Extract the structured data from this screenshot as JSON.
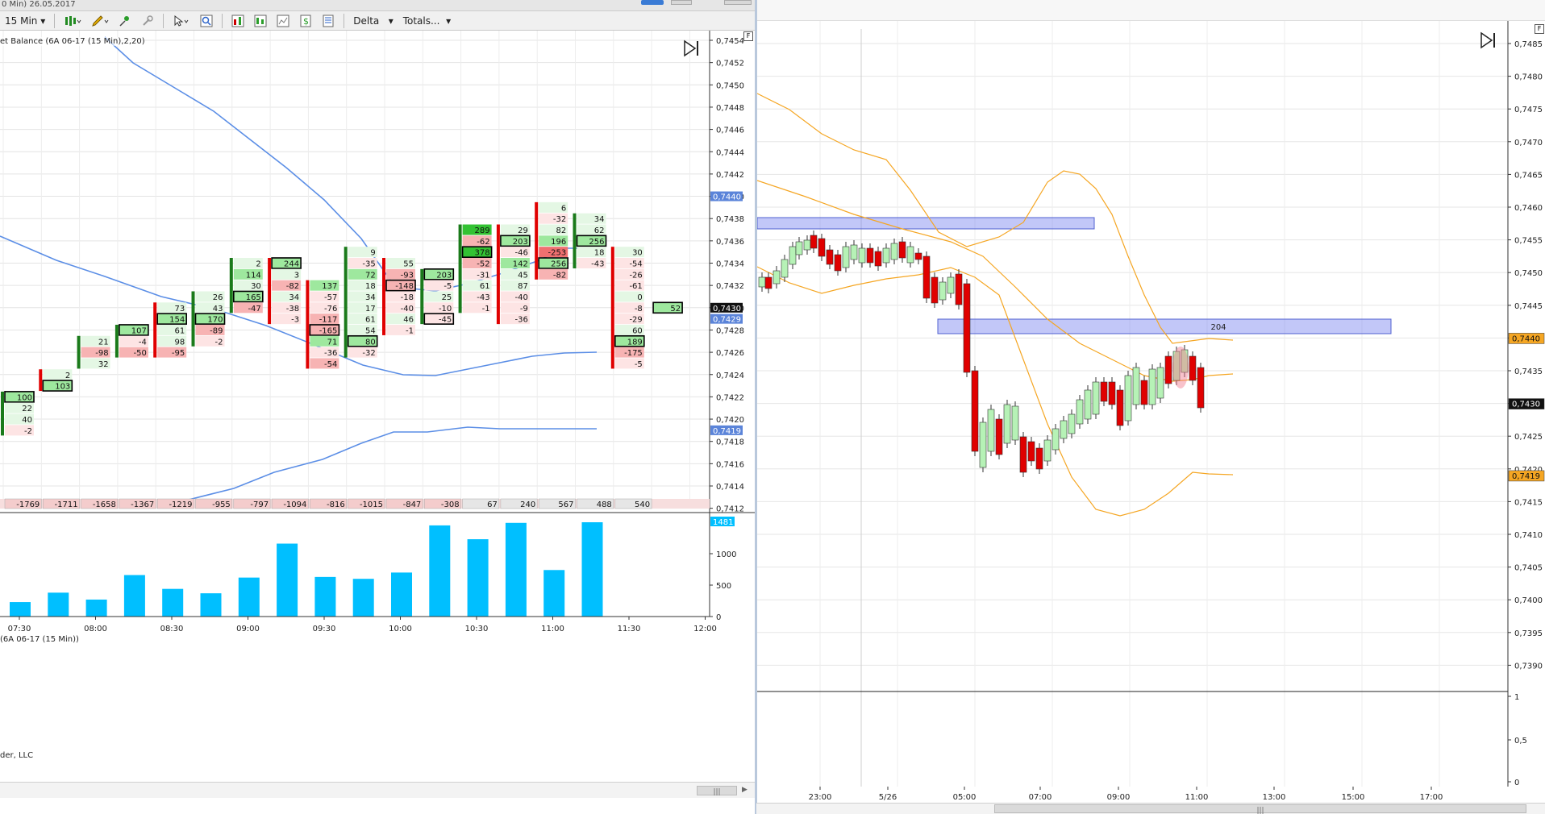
{
  "left_window": {
    "title_fragment": "0 Min)  26.05.2017",
    "toolbar": {
      "interval_label": "15 Min",
      "delta_label": "Delta",
      "totals_label": "Totals..."
    },
    "indicator_label": "et Balance  (6A 06-17 (15 Min),2,20)",
    "volume_label": "(6A 06-17 (15 Min))",
    "copyright": "der, LLC",
    "price_axis": [
      "0,7454",
      "0,7452",
      "0,7450",
      "0,7448",
      "0,7446",
      "0,7444",
      "0,7442",
      "0,7440",
      "0,7438",
      "0,7436",
      "0,7434",
      "0,7432",
      "0,7430",
      "0,7428",
      "0,7426",
      "0,7424",
      "0,7422",
      "0,7420",
      "0,7418",
      "0,7416",
      "0,7414",
      "0,7412"
    ],
    "price_markers": {
      "upper": "0,7440",
      "current": "0,7430",
      "current_sub": "0,7429",
      "lower": "0,7419"
    },
    "volume_axis": [
      "1000",
      "500",
      "0"
    ],
    "volume_marker": "1481",
    "time_axis": [
      "07:30",
      "08:00",
      "08:30",
      "09:00",
      "09:30",
      "10:00",
      "10:30",
      "11:00",
      "11:30",
      "12:00"
    ],
    "totals_row": [
      "-1769",
      "-1711",
      "-1658",
      "-1367",
      "-1219",
      "-955",
      "-797",
      "-1094",
      "-816",
      "-1015",
      "-847",
      "-308",
      "67",
      "240",
      "567",
      "488",
      "540"
    ]
  },
  "right_window": {
    "price_axis": [
      "0,7485",
      "0,7480",
      "0,7475",
      "0,7470",
      "0,7465",
      "0,7460",
      "0,7455",
      "0,7450",
      "0,7445",
      "0,7440",
      "0,7435",
      "0,7430",
      "0,7425",
      "0,7420",
      "0,7415",
      "0,7410",
      "0,7405",
      "0,7400",
      "0,7395",
      "0,7390"
    ],
    "price_markers": {
      "upper": "0,7440",
      "current": "0,7430",
      "lower": "0,7419"
    },
    "indicator_axis": [
      "1",
      "0,5",
      "0"
    ],
    "time_axis": [
      "23:00",
      "5/26",
      "05:00",
      "07:00",
      "09:00",
      "11:00",
      "13:00",
      "15:00",
      "17:00"
    ],
    "zone_label": "204"
  },
  "chart_data": [
    {
      "type": "bar",
      "title": "",
      "series": [
        {
          "name": "",
          "values": [
            230,
            380,
            270,
            660,
            440,
            370,
            620,
            1160,
            630,
            600,
            700,
            1450,
            1230,
            1490,
            740,
            1500
          ]
        }
      ],
      "categories": [
        "07:30",
        "07:45",
        "08:00",
        "08:15",
        "08:30",
        "08:45",
        "09:00",
        "09:15",
        "09:30",
        "09:45",
        "10:00",
        "10:15",
        "10:30",
        "10:45",
        "11:00",
        "11:15"
      ],
      "ylim": [
        0,
        1500
      ],
      "bar_color": "#00bfff"
    }
  ],
  "footprint": [
    {
      "cells": [
        [
          "0,7422",
          "100",
          "box-g"
        ],
        [
          "0,7421",
          "22",
          ""
        ],
        [
          "0,7420",
          "40",
          ""
        ],
        [
          "0,7419",
          "-2",
          ""
        ]
      ]
    },
    {
      "cells": [
        [
          "0,7424",
          "2",
          ""
        ],
        [
          "0,7423",
          "103",
          "box-g"
        ]
      ]
    },
    {
      "cells": [
        [
          "0,7427",
          "21",
          ""
        ],
        [
          "0,7426",
          "-98",
          "r"
        ],
        [
          "0,7425",
          "32",
          ""
        ]
      ]
    },
    {
      "cells": [
        [
          "0,7428",
          "107",
          "box-g"
        ],
        [
          "0,7427",
          "-4",
          ""
        ],
        [
          "0,7426",
          "-50",
          "r"
        ]
      ]
    },
    {
      "cells": [
        [
          "0,7430",
          "73",
          ""
        ],
        [
          "0,7429",
          "154",
          "box-g"
        ],
        [
          "0,7428",
          "61",
          ""
        ],
        [
          "0,7427",
          "98",
          ""
        ],
        [
          "0,7426",
          "-95",
          "r"
        ]
      ]
    },
    {
      "cells": [
        [
          "0,7431",
          "26",
          ""
        ],
        [
          "0,7430",
          "43",
          ""
        ],
        [
          "0,7429",
          "170",
          "box-g"
        ],
        [
          "0,7428",
          "-89",
          "r"
        ],
        [
          "0,7427",
          "-2",
          ""
        ]
      ]
    },
    {
      "cells": [
        [
          "0,7434",
          "2",
          ""
        ],
        [
          "0,7433",
          "114",
          "g"
        ],
        [
          "0,7432",
          "30",
          ""
        ],
        [
          "0,7431",
          "165",
          "box-g"
        ],
        [
          "0,7430",
          "-47",
          "r"
        ]
      ]
    },
    {
      "cells": [
        [
          "0,7434",
          "244",
          "box-g"
        ],
        [
          "0,7433",
          "3",
          ""
        ],
        [
          "0,7432",
          "-82",
          "r"
        ],
        [
          "0,7431",
          "34",
          ""
        ],
        [
          "0,7430",
          "-38",
          ""
        ],
        [
          "0,7429",
          "-3",
          ""
        ]
      ]
    },
    {
      "cells": [
        [
          "0,7432",
          "137",
          "g"
        ],
        [
          "0,7431",
          "-57",
          ""
        ],
        [
          "0,7430",
          "-76",
          ""
        ],
        [
          "0,7429",
          "-117",
          "r"
        ],
        [
          "0,7428",
          "-165",
          "box-r"
        ],
        [
          "0,7427",
          "71",
          "g"
        ],
        [
          "0,7426",
          "-36",
          ""
        ],
        [
          "0,7425",
          "-54",
          "r"
        ]
      ]
    },
    {
      "cells": [
        [
          "0,7435",
          "9",
          ""
        ],
        [
          "0,7434",
          "-35",
          ""
        ],
        [
          "0,7433",
          "72",
          "g"
        ],
        [
          "0,7432",
          "18",
          ""
        ],
        [
          "0,7431",
          "34",
          ""
        ],
        [
          "0,7430",
          "17",
          ""
        ],
        [
          "0,7429",
          "61",
          ""
        ],
        [
          "0,7428",
          "54",
          ""
        ],
        [
          "0,7427",
          "80",
          "box-g"
        ],
        [
          "0,7426",
          "-32",
          ""
        ]
      ]
    },
    {
      "cells": [
        [
          "0,7434",
          "55",
          ""
        ],
        [
          "0,7433",
          "-93",
          "r"
        ],
        [
          "0,7432",
          "-148",
          "box-r"
        ],
        [
          "0,7431",
          "-18",
          ""
        ],
        [
          "0,7430",
          "-40",
          ""
        ],
        [
          "0,7429",
          "46",
          ""
        ],
        [
          "0,7428",
          "-1",
          ""
        ]
      ]
    },
    {
      "cells": [
        [
          "0,7433",
          "203",
          "box-g"
        ],
        [
          "0,7432",
          "-5",
          ""
        ],
        [
          "0,7431",
          "25",
          ""
        ],
        [
          "0,7430",
          "-10",
          ""
        ],
        [
          "0,7429",
          "-45",
          "box"
        ]
      ]
    },
    {
      "cells": [
        [
          "0,7437",
          "289",
          "gg"
        ],
        [
          "0,7436",
          "-62",
          "r"
        ],
        [
          "0,7435",
          "378",
          "box-gg"
        ],
        [
          "0,7434",
          "-52",
          "r"
        ],
        [
          "0,7433",
          "-31",
          ""
        ],
        [
          "0,7432",
          "61",
          ""
        ],
        [
          "0,7431",
          "-43",
          ""
        ],
        [
          "0,7430",
          "-1",
          ""
        ]
      ]
    },
    {
      "cells": [
        [
          "0,7437",
          "29",
          ""
        ],
        [
          "0,7436",
          "203",
          "box-g"
        ],
        [
          "0,7435",
          "-46",
          ""
        ],
        [
          "0,7434",
          "142",
          "g"
        ],
        [
          "0,7433",
          "45",
          ""
        ],
        [
          "0,7432",
          "87",
          ""
        ],
        [
          "0,7431",
          "-40",
          ""
        ],
        [
          "0,7430",
          "-9",
          ""
        ],
        [
          "0,7429",
          "-36",
          ""
        ]
      ]
    },
    {
      "cells": [
        [
          "0,7439",
          "6",
          ""
        ],
        [
          "0,7438",
          "-32",
          ""
        ],
        [
          "0,7437",
          "82",
          ""
        ],
        [
          "0,7436",
          "196",
          "g"
        ],
        [
          "0,7435",
          "-253",
          "rr"
        ],
        [
          "0,7434",
          "256",
          "box-g"
        ],
        [
          "0,7433",
          "-82",
          "r"
        ]
      ]
    },
    {
      "cells": [
        [
          "0,7438",
          "34",
          ""
        ],
        [
          "0,7437",
          "62",
          ""
        ],
        [
          "0,7436",
          "256",
          "box-g"
        ],
        [
          "0,7435",
          "18",
          ""
        ],
        [
          "0,7434",
          "-43",
          ""
        ]
      ]
    },
    {
      "cells": [
        [
          "0,7435",
          "30",
          ""
        ],
        [
          "0,7434",
          "-54",
          ""
        ],
        [
          "0,7433",
          "-26",
          ""
        ],
        [
          "0,7432",
          "-61",
          ""
        ],
        [
          "0,7431",
          "0",
          ""
        ],
        [
          "0,7430",
          "-8",
          ""
        ],
        [
          "0,7429",
          "-29",
          ""
        ],
        [
          "0,7428",
          "60",
          ""
        ],
        [
          "0,7427",
          "189",
          "box-g"
        ],
        [
          "0,7426",
          "-175",
          "r"
        ],
        [
          "0,7425",
          "-5",
          ""
        ]
      ]
    },
    {
      "cells": [
        [
          "0,7430",
          "52",
          "box-g"
        ]
      ]
    }
  ]
}
